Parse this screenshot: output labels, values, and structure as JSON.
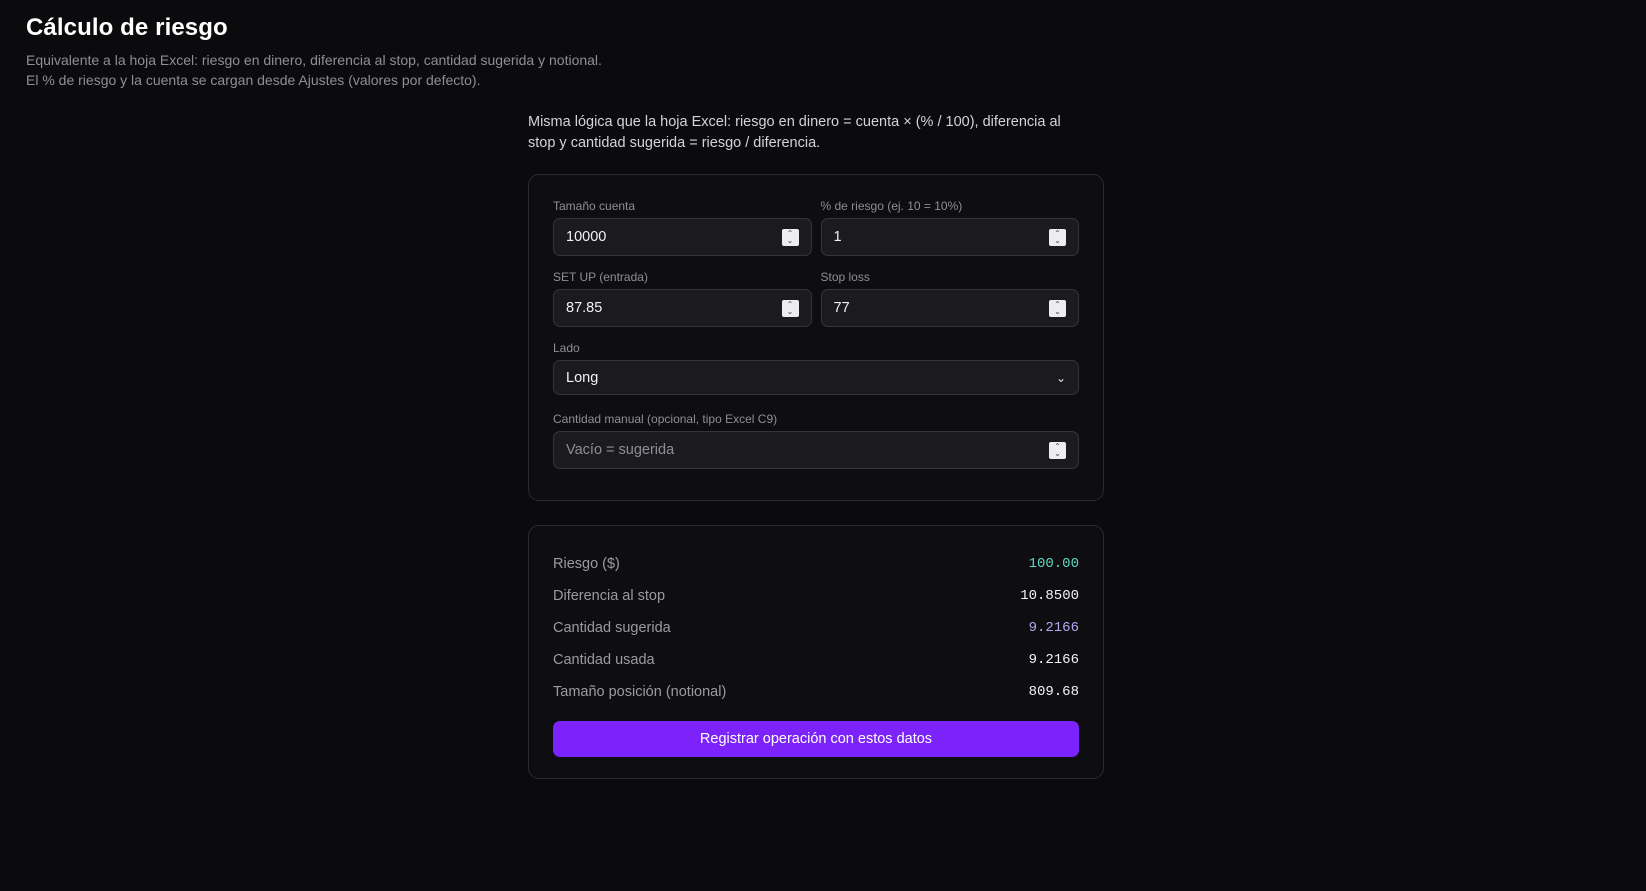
{
  "header": {
    "title": "Cálculo de riesgo",
    "subtitle": "Equivalente a la hoja Excel: riesgo en dinero, diferencia al stop, cantidad sugerida y notional. El % de riesgo y la cuenta se cargan desde Ajustes (valores por defecto)."
  },
  "intro": "Misma lógica que la hoja Excel: riesgo en dinero = cuenta × (% / 100), diferencia al stop y cantidad sugerida = riesgo / diferencia.",
  "form": {
    "account_size": {
      "label": "Tamaño cuenta",
      "value": "10000"
    },
    "risk_pct": {
      "label": "% de riesgo (ej. 10 = 10%)",
      "value": "1"
    },
    "setup": {
      "label": "SET UP (entrada)",
      "value": "87.85"
    },
    "stop_loss": {
      "label": "Stop loss",
      "value": "77"
    },
    "side": {
      "label": "Lado",
      "value": "Long"
    },
    "manual_qty": {
      "label": "Cantidad manual (opcional, tipo Excel C9)",
      "value": "",
      "placeholder": "Vacío = sugerida"
    }
  },
  "results": {
    "risk": {
      "label": "Riesgo ($)",
      "value": "100.00",
      "color": "#5fd6c4"
    },
    "stop_diff": {
      "label": "Diferencia al stop",
      "value": "10.8500"
    },
    "suggested_qty": {
      "label": "Cantidad sugerida",
      "value": "9.2166",
      "color": "#b6a8f5"
    },
    "used_qty": {
      "label": "Cantidad usada",
      "value": "9.2166"
    },
    "notional": {
      "label": "Tamaño posición (notional)",
      "value": "809.68"
    }
  },
  "actions": {
    "register_label": "Registrar operación con estos datos",
    "accent": "#7c22fb"
  }
}
